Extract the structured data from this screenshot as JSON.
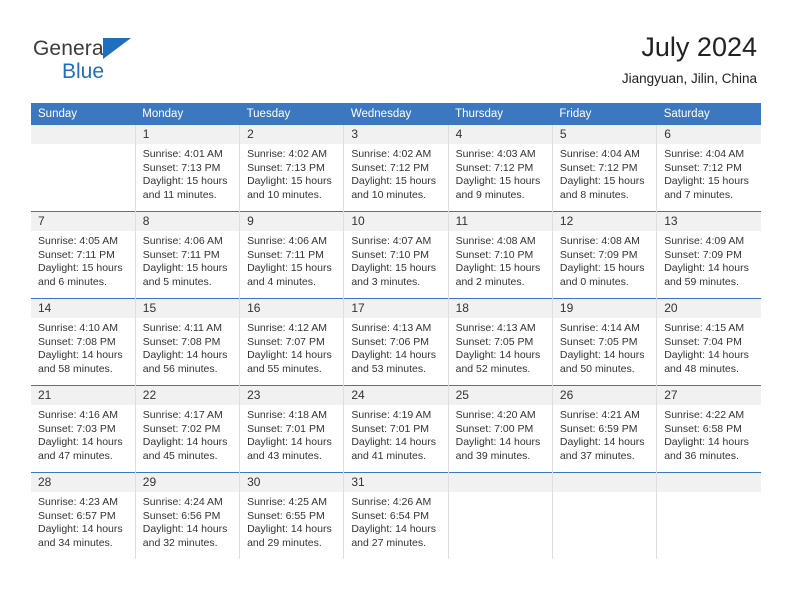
{
  "logo": {
    "text_primary": "General",
    "text_secondary": "Blue",
    "triangle_color": "#1f6fc0"
  },
  "header": {
    "title": "July 2024",
    "subtitle": "Jiangyuan, Jilin, China"
  },
  "theme": {
    "accent": "#3c78bf",
    "header_text": "#ffffff",
    "daynum_band": "#f1f1f1",
    "body_text": "#333333"
  },
  "weekday_headers": [
    "Sunday",
    "Monday",
    "Tuesday",
    "Wednesday",
    "Thursday",
    "Friday",
    "Saturday"
  ],
  "labels": {
    "sunrise_prefix": "Sunrise:",
    "sunset_prefix": "Sunset:",
    "daylight_prefix": "Daylight:"
  },
  "weeks": [
    [
      {
        "day": "",
        "blank": true,
        "line1": "",
        "line2": "",
        "line3": "",
        "line4": ""
      },
      {
        "day": "1",
        "line1": "Sunrise: 4:01 AM",
        "line2": "Sunset: 7:13 PM",
        "line3": "Daylight: 15 hours",
        "line4": "and 11 minutes."
      },
      {
        "day": "2",
        "line1": "Sunrise: 4:02 AM",
        "line2": "Sunset: 7:13 PM",
        "line3": "Daylight: 15 hours",
        "line4": "and 10 minutes."
      },
      {
        "day": "3",
        "line1": "Sunrise: 4:02 AM",
        "line2": "Sunset: 7:12 PM",
        "line3": "Daylight: 15 hours",
        "line4": "and 10 minutes."
      },
      {
        "day": "4",
        "line1": "Sunrise: 4:03 AM",
        "line2": "Sunset: 7:12 PM",
        "line3": "Daylight: 15 hours",
        "line4": "and 9 minutes."
      },
      {
        "day": "5",
        "line1": "Sunrise: 4:04 AM",
        "line2": "Sunset: 7:12 PM",
        "line3": "Daylight: 15 hours",
        "line4": "and 8 minutes."
      },
      {
        "day": "6",
        "line1": "Sunrise: 4:04 AM",
        "line2": "Sunset: 7:12 PM",
        "line3": "Daylight: 15 hours",
        "line4": "and 7 minutes."
      }
    ],
    [
      {
        "day": "7",
        "line1": "Sunrise: 4:05 AM",
        "line2": "Sunset: 7:11 PM",
        "line3": "Daylight: 15 hours",
        "line4": "and 6 minutes."
      },
      {
        "day": "8",
        "line1": "Sunrise: 4:06 AM",
        "line2": "Sunset: 7:11 PM",
        "line3": "Daylight: 15 hours",
        "line4": "and 5 minutes."
      },
      {
        "day": "9",
        "line1": "Sunrise: 4:06 AM",
        "line2": "Sunset: 7:11 PM",
        "line3": "Daylight: 15 hours",
        "line4": "and 4 minutes."
      },
      {
        "day": "10",
        "line1": "Sunrise: 4:07 AM",
        "line2": "Sunset: 7:10 PM",
        "line3": "Daylight: 15 hours",
        "line4": "and 3 minutes."
      },
      {
        "day": "11",
        "line1": "Sunrise: 4:08 AM",
        "line2": "Sunset: 7:10 PM",
        "line3": "Daylight: 15 hours",
        "line4": "and 2 minutes."
      },
      {
        "day": "12",
        "line1": "Sunrise: 4:08 AM",
        "line2": "Sunset: 7:09 PM",
        "line3": "Daylight: 15 hours",
        "line4": "and 0 minutes."
      },
      {
        "day": "13",
        "line1": "Sunrise: 4:09 AM",
        "line2": "Sunset: 7:09 PM",
        "line3": "Daylight: 14 hours",
        "line4": "and 59 minutes."
      }
    ],
    [
      {
        "day": "14",
        "line1": "Sunrise: 4:10 AM",
        "line2": "Sunset: 7:08 PM",
        "line3": "Daylight: 14 hours",
        "line4": "and 58 minutes."
      },
      {
        "day": "15",
        "line1": "Sunrise: 4:11 AM",
        "line2": "Sunset: 7:08 PM",
        "line3": "Daylight: 14 hours",
        "line4": "and 56 minutes."
      },
      {
        "day": "16",
        "line1": "Sunrise: 4:12 AM",
        "line2": "Sunset: 7:07 PM",
        "line3": "Daylight: 14 hours",
        "line4": "and 55 minutes."
      },
      {
        "day": "17",
        "line1": "Sunrise: 4:13 AM",
        "line2": "Sunset: 7:06 PM",
        "line3": "Daylight: 14 hours",
        "line4": "and 53 minutes."
      },
      {
        "day": "18",
        "line1": "Sunrise: 4:13 AM",
        "line2": "Sunset: 7:05 PM",
        "line3": "Daylight: 14 hours",
        "line4": "and 52 minutes."
      },
      {
        "day": "19",
        "line1": "Sunrise: 4:14 AM",
        "line2": "Sunset: 7:05 PM",
        "line3": "Daylight: 14 hours",
        "line4": "and 50 minutes."
      },
      {
        "day": "20",
        "line1": "Sunrise: 4:15 AM",
        "line2": "Sunset: 7:04 PM",
        "line3": "Daylight: 14 hours",
        "line4": "and 48 minutes."
      }
    ],
    [
      {
        "day": "21",
        "line1": "Sunrise: 4:16 AM",
        "line2": "Sunset: 7:03 PM",
        "line3": "Daylight: 14 hours",
        "line4": "and 47 minutes."
      },
      {
        "day": "22",
        "line1": "Sunrise: 4:17 AM",
        "line2": "Sunset: 7:02 PM",
        "line3": "Daylight: 14 hours",
        "line4": "and 45 minutes."
      },
      {
        "day": "23",
        "line1": "Sunrise: 4:18 AM",
        "line2": "Sunset: 7:01 PM",
        "line3": "Daylight: 14 hours",
        "line4": "and 43 minutes."
      },
      {
        "day": "24",
        "line1": "Sunrise: 4:19 AM",
        "line2": "Sunset: 7:01 PM",
        "line3": "Daylight: 14 hours",
        "line4": "and 41 minutes."
      },
      {
        "day": "25",
        "line1": "Sunrise: 4:20 AM",
        "line2": "Sunset: 7:00 PM",
        "line3": "Daylight: 14 hours",
        "line4": "and 39 minutes."
      },
      {
        "day": "26",
        "line1": "Sunrise: 4:21 AM",
        "line2": "Sunset: 6:59 PM",
        "line3": "Daylight: 14 hours",
        "line4": "and 37 minutes."
      },
      {
        "day": "27",
        "line1": "Sunrise: 4:22 AM",
        "line2": "Sunset: 6:58 PM",
        "line3": "Daylight: 14 hours",
        "line4": "and 36 minutes."
      }
    ],
    [
      {
        "day": "28",
        "line1": "Sunrise: 4:23 AM",
        "line2": "Sunset: 6:57 PM",
        "line3": "Daylight: 14 hours",
        "line4": "and 34 minutes."
      },
      {
        "day": "29",
        "line1": "Sunrise: 4:24 AM",
        "line2": "Sunset: 6:56 PM",
        "line3": "Daylight: 14 hours",
        "line4": "and 32 minutes."
      },
      {
        "day": "30",
        "line1": "Sunrise: 4:25 AM",
        "line2": "Sunset: 6:55 PM",
        "line3": "Daylight: 14 hours",
        "line4": "and 29 minutes."
      },
      {
        "day": "31",
        "line1": "Sunrise: 4:26 AM",
        "line2": "Sunset: 6:54 PM",
        "line3": "Daylight: 14 hours",
        "line4": "and 27 minutes."
      },
      {
        "day": "",
        "blank": true,
        "line1": "",
        "line2": "",
        "line3": "",
        "line4": ""
      },
      {
        "day": "",
        "blank": true,
        "line1": "",
        "line2": "",
        "line3": "",
        "line4": ""
      },
      {
        "day": "",
        "blank": true,
        "line1": "",
        "line2": "",
        "line3": "",
        "line4": ""
      }
    ]
  ]
}
